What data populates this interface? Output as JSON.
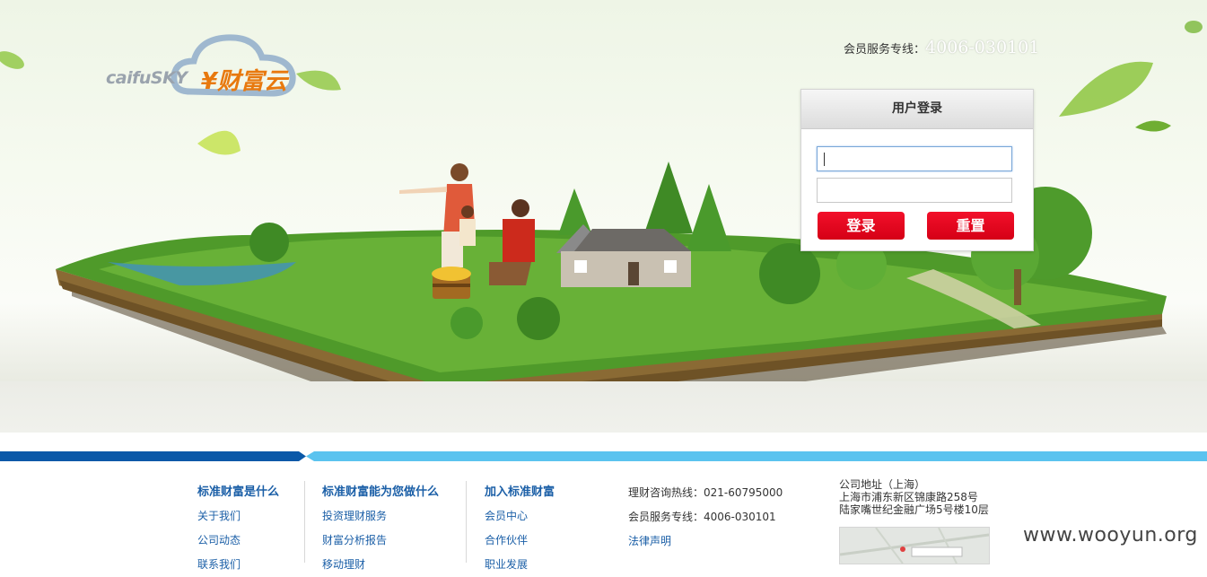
{
  "header": {
    "logo_en": "caifuSKY",
    "logo_cn": "¥财富云",
    "hotline_label": "会员服务专线：",
    "hotline_number": "4006-030101"
  },
  "login": {
    "title": "用户登录",
    "username_value": "",
    "password_value": "",
    "login_label": "登录",
    "reset_label": "重置"
  },
  "footer": {
    "col1": {
      "heading": "标准财富是什么",
      "links": [
        "关于我们",
        "公司动态",
        "联系我们"
      ]
    },
    "col2": {
      "heading": "标准财富能为您做什么",
      "links": [
        "投资理财服务",
        "财富分析报告",
        "移动理财"
      ]
    },
    "col3": {
      "heading": "加入标准财富",
      "links": [
        "会员中心",
        "合作伙伴",
        "职业发展"
      ]
    },
    "col4": {
      "consult": "理财咨询热线：021-60795000",
      "service": "会员服务专线：4006-030101",
      "legal": "法律声明"
    },
    "address": {
      "title": "公司地址（上海）",
      "line1": "上海市浦东新区锦康路258号",
      "line2": "陆家嘴世纪金融广场5号楼10层"
    }
  },
  "watermark": "www.wooyun.org",
  "colors": {
    "accent_red": "#e30a1f",
    "stripe_dark": "#0a58a8",
    "stripe_light": "#5bc3ef",
    "link_blue": "#1b5fa7"
  }
}
